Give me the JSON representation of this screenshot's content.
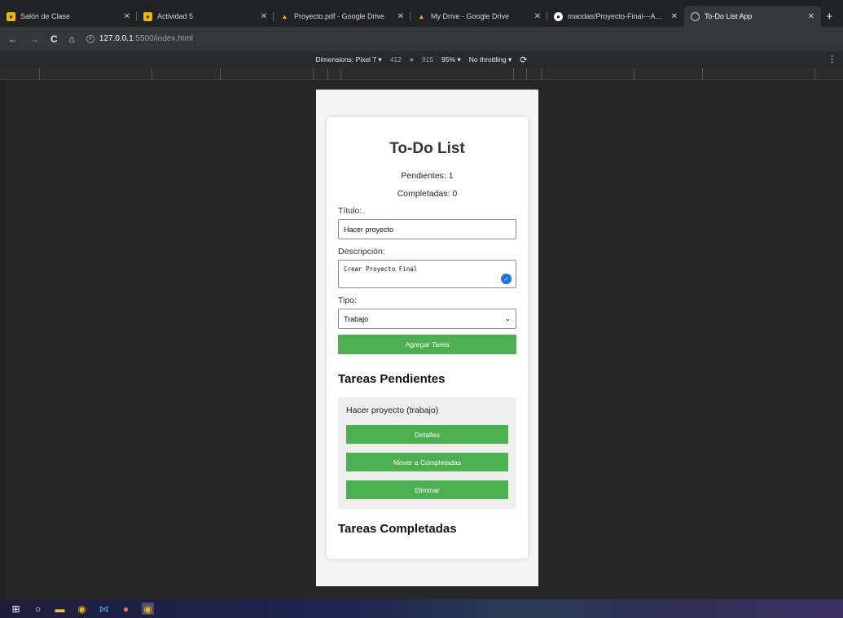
{
  "browser": {
    "tabs": [
      {
        "label": "Salón de Clase",
        "icon": "classroom-icon"
      },
      {
        "label": "Actividad 5",
        "icon": "classroom-icon"
      },
      {
        "label": "Proyecto.pdf - Google Drive",
        "icon": "drive-icon"
      },
      {
        "label": "My Drive - Google Drive",
        "icon": "drive-icon"
      },
      {
        "label": "maodas/Proyecto-Final---Aplica",
        "icon": "github-icon"
      },
      {
        "label": "To-Do List App",
        "icon": "globe-icon",
        "active": true
      }
    ],
    "url_host": "127.0.0.1",
    "url_path": ":5500/index.html"
  },
  "devtools": {
    "device": "Dimensions: Pixel 7 ▾",
    "width": "412",
    "times": "×",
    "height": "915",
    "zoom": "95% ▾",
    "throttling": "No throttling ▾"
  },
  "app": {
    "title": "To-Do List",
    "pending_count": "Pendientes: 1",
    "completed_count": "Completadas: 0",
    "title_label": "Título:",
    "title_value": "Hacer proyecto",
    "desc_label": "Descripción:",
    "desc_value": "Crear Proyecto Final",
    "type_label": "Tipo:",
    "type_value": "Trabajo",
    "add_button": "Agregar Tarea",
    "pending_section": "Tareas Pendientes",
    "completed_section": "Tareas Completadas",
    "tasks": [
      {
        "title": "Hacer proyecto (trabajo)",
        "details": "Detalles",
        "move": "Mover a Completadas",
        "delete": "Eliminar"
      }
    ]
  },
  "colors": {
    "accent": "#4caf50",
    "tab_active": "#35363a"
  }
}
